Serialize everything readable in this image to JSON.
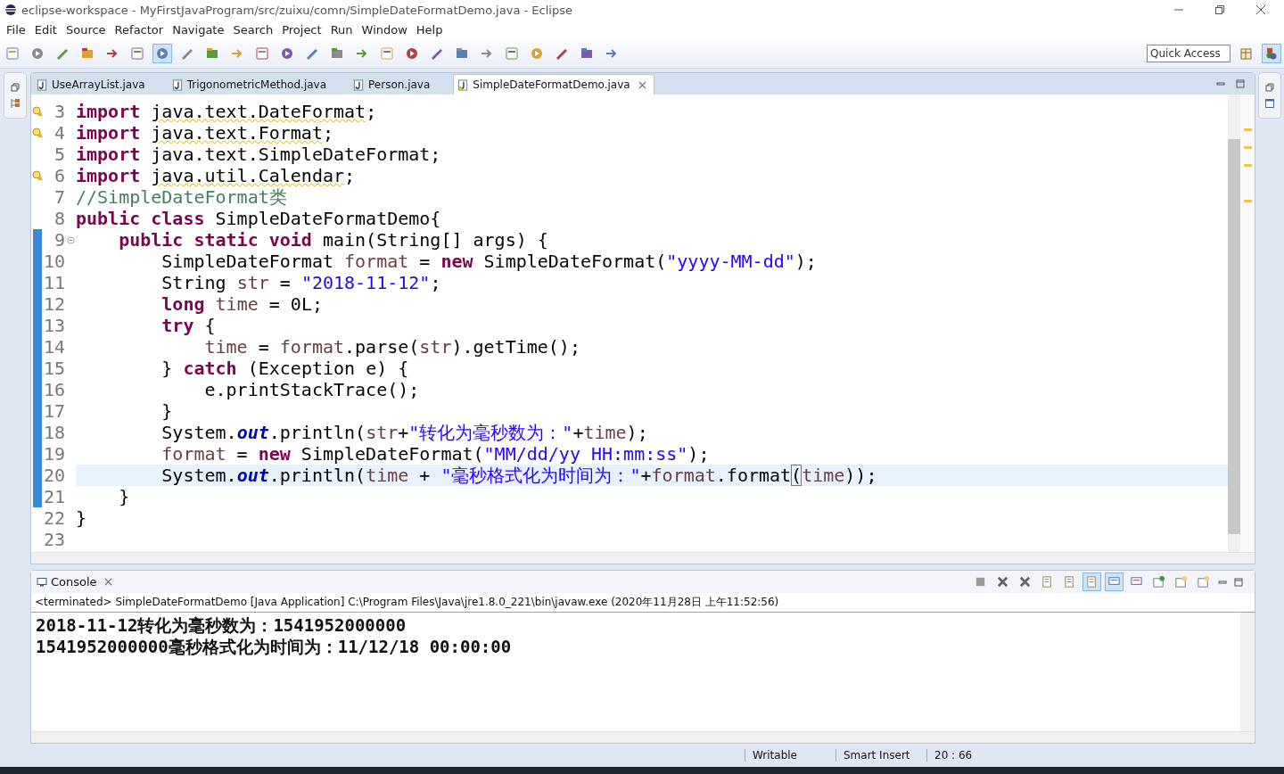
{
  "window": {
    "title": "eclipse-workspace - MyFirstJavaProgram/src/zuixu/comn/SimpleDateFormatDemo.java - Eclipse"
  },
  "menu": [
    "File",
    "Edit",
    "Source",
    "Refactor",
    "Navigate",
    "Search",
    "Project",
    "Run",
    "Window",
    "Help"
  ],
  "quick_access": {
    "placeholder": "Quick Access"
  },
  "editor_tabs": [
    {
      "label": "UseArrayList.java",
      "selected": false,
      "warning": false
    },
    {
      "label": "TrigonometricMethod.java",
      "selected": false,
      "warning": false
    },
    {
      "label": "Person.java",
      "selected": false,
      "warning": false
    },
    {
      "label": "SimpleDateFormatDemo.java",
      "selected": true,
      "warning": true
    }
  ],
  "code": {
    "lines": [
      {
        "number": "3",
        "warning": true,
        "changed": false,
        "current": false,
        "tokens": [
          {
            "kind": "kw",
            "text": "import "
          },
          {
            "kind": "plain",
            "text": "java.text.DateFormat",
            "squiggle": true
          },
          {
            "kind": "plain",
            "text": ";"
          }
        ]
      },
      {
        "number": "4",
        "warning": true,
        "changed": false,
        "current": false,
        "tokens": [
          {
            "kind": "kw",
            "text": "import "
          },
          {
            "kind": "plain",
            "text": "java.text.Format",
            "squiggle": true
          },
          {
            "kind": "plain",
            "text": ";"
          }
        ]
      },
      {
        "number": "5",
        "warning": false,
        "changed": false,
        "current": false,
        "tokens": [
          {
            "kind": "kw",
            "text": "import"
          },
          {
            "kind": "plain",
            "text": " java.text.SimpleDateFormat;"
          }
        ]
      },
      {
        "number": "6",
        "warning": true,
        "changed": false,
        "current": false,
        "tokens": [
          {
            "kind": "kw",
            "text": "import "
          },
          {
            "kind": "plain",
            "text": "java.util.Calendar",
            "squiggle": true
          },
          {
            "kind": "plain",
            "text": ";"
          }
        ]
      },
      {
        "number": "7",
        "warning": false,
        "changed": false,
        "current": false,
        "tokens": [
          {
            "kind": "comment",
            "text": "//SimpleDateFormat类"
          }
        ]
      },
      {
        "number": "8",
        "warning": false,
        "changed": false,
        "current": false,
        "tokens": [
          {
            "kind": "kw",
            "text": "public class"
          },
          {
            "kind": "plain",
            "text": " SimpleDateFormatDemo{"
          }
        ]
      },
      {
        "number": "9",
        "warning": false,
        "changed": true,
        "current": false,
        "folding": true,
        "tokens": [
          {
            "kind": "kw",
            "text": "    public static void"
          },
          {
            "kind": "plain",
            "text": " main(String[] args) {"
          }
        ]
      },
      {
        "number": "10",
        "warning": false,
        "changed": true,
        "current": false,
        "tokens": [
          {
            "kind": "plain",
            "text": "        SimpleDateFormat "
          },
          {
            "kind": "var",
            "text": "format"
          },
          {
            "kind": "plain",
            "text": " = "
          },
          {
            "kind": "kw",
            "text": "new"
          },
          {
            "kind": "plain",
            "text": " SimpleDateFormat("
          },
          {
            "kind": "str",
            "text": "\"yyyy-MM-dd\""
          },
          {
            "kind": "plain",
            "text": ");"
          }
        ]
      },
      {
        "number": "11",
        "warning": false,
        "changed": true,
        "current": false,
        "tokens": [
          {
            "kind": "plain",
            "text": "        String "
          },
          {
            "kind": "var",
            "text": "str"
          },
          {
            "kind": "plain",
            "text": " = "
          },
          {
            "kind": "str",
            "text": "\"2018-11-12\""
          },
          {
            "kind": "plain",
            "text": ";"
          }
        ]
      },
      {
        "number": "12",
        "warning": false,
        "changed": true,
        "current": false,
        "tokens": [
          {
            "kind": "kw",
            "text": "        long "
          },
          {
            "kind": "var",
            "text": "time"
          },
          {
            "kind": "plain",
            "text": " = 0L;"
          }
        ]
      },
      {
        "number": "13",
        "warning": false,
        "changed": true,
        "current": false,
        "tokens": [
          {
            "kind": "kw",
            "text": "        try"
          },
          {
            "kind": "plain",
            "text": " {"
          }
        ]
      },
      {
        "number": "14",
        "warning": false,
        "changed": true,
        "current": false,
        "tokens": [
          {
            "kind": "var",
            "text": "            time"
          },
          {
            "kind": "plain",
            "text": " = "
          },
          {
            "kind": "var",
            "text": "format"
          },
          {
            "kind": "plain",
            "text": ".parse("
          },
          {
            "kind": "var",
            "text": "str"
          },
          {
            "kind": "plain",
            "text": ").getTime();"
          }
        ]
      },
      {
        "number": "15",
        "warning": false,
        "changed": true,
        "current": false,
        "tokens": [
          {
            "kind": "plain",
            "text": "        } "
          },
          {
            "kind": "kw",
            "text": "catch"
          },
          {
            "kind": "plain",
            "text": " (Exception e) {"
          }
        ]
      },
      {
        "number": "16",
        "warning": false,
        "changed": true,
        "current": false,
        "tokens": [
          {
            "kind": "plain",
            "text": "            e.printStackTrace();"
          }
        ]
      },
      {
        "number": "17",
        "warning": false,
        "changed": true,
        "current": false,
        "tokens": [
          {
            "kind": "plain",
            "text": "        }"
          }
        ]
      },
      {
        "number": "18",
        "warning": false,
        "changed": true,
        "current": false,
        "tokens": [
          {
            "kind": "plain",
            "text": "        System."
          },
          {
            "kind": "field",
            "text": "out"
          },
          {
            "kind": "plain",
            "text": ".println("
          },
          {
            "kind": "var",
            "text": "str"
          },
          {
            "kind": "plain",
            "text": "+"
          },
          {
            "kind": "str",
            "text": "\"转化为毫秒数为：\""
          },
          {
            "kind": "plain",
            "text": "+"
          },
          {
            "kind": "var",
            "text": "time"
          },
          {
            "kind": "plain",
            "text": ");"
          }
        ]
      },
      {
        "number": "19",
        "warning": false,
        "changed": true,
        "current": false,
        "tokens": [
          {
            "kind": "var",
            "text": "        format"
          },
          {
            "kind": "plain",
            "text": " = "
          },
          {
            "kind": "kw",
            "text": "new"
          },
          {
            "kind": "plain",
            "text": " SimpleDateFormat("
          },
          {
            "kind": "str",
            "text": "\"MM/dd/yy HH:mm:ss\""
          },
          {
            "kind": "plain",
            "text": ");"
          }
        ]
      },
      {
        "number": "20",
        "warning": false,
        "changed": true,
        "current": true,
        "tokens": [
          {
            "kind": "plain",
            "text": "        System."
          },
          {
            "kind": "field",
            "text": "out"
          },
          {
            "kind": "plain",
            "text": ".println("
          },
          {
            "kind": "var",
            "text": "time"
          },
          {
            "kind": "plain",
            "text": " + "
          },
          {
            "kind": "str",
            "text": "\"毫秒格式化为时间为：\""
          },
          {
            "kind": "plain",
            "text": "+"
          },
          {
            "kind": "var",
            "text": "format"
          },
          {
            "kind": "plain",
            "text": ".format"
          },
          {
            "kind": "match",
            "text": "("
          },
          {
            "kind": "var",
            "text": "time"
          },
          {
            "kind": "plain",
            "text": "));"
          }
        ]
      },
      {
        "number": "21",
        "warning": false,
        "changed": true,
        "current": false,
        "tokens": [
          {
            "kind": "plain",
            "text": "    }"
          }
        ]
      },
      {
        "number": "22",
        "warning": false,
        "changed": false,
        "current": false,
        "tokens": [
          {
            "kind": "plain",
            "text": "}"
          }
        ]
      },
      {
        "number": "23",
        "warning": false,
        "changed": false,
        "current": false
      }
    ]
  },
  "console": {
    "tab": "Console",
    "header": "<terminated> SimpleDateFormatDemo [Java Application] C:\\Program Files\\Java\\jre1.8.0_221\\bin\\javaw.exe (2020年11月28日 上午11:52:56)",
    "output": [
      "2018-11-12转化为毫秒数为：1541952000000",
      "1541952000000毫秒格式化为时间为：11/12/18 00:00:00"
    ]
  },
  "status_bar": [
    "Writable",
    "Smart Insert",
    "20 : 66"
  ]
}
